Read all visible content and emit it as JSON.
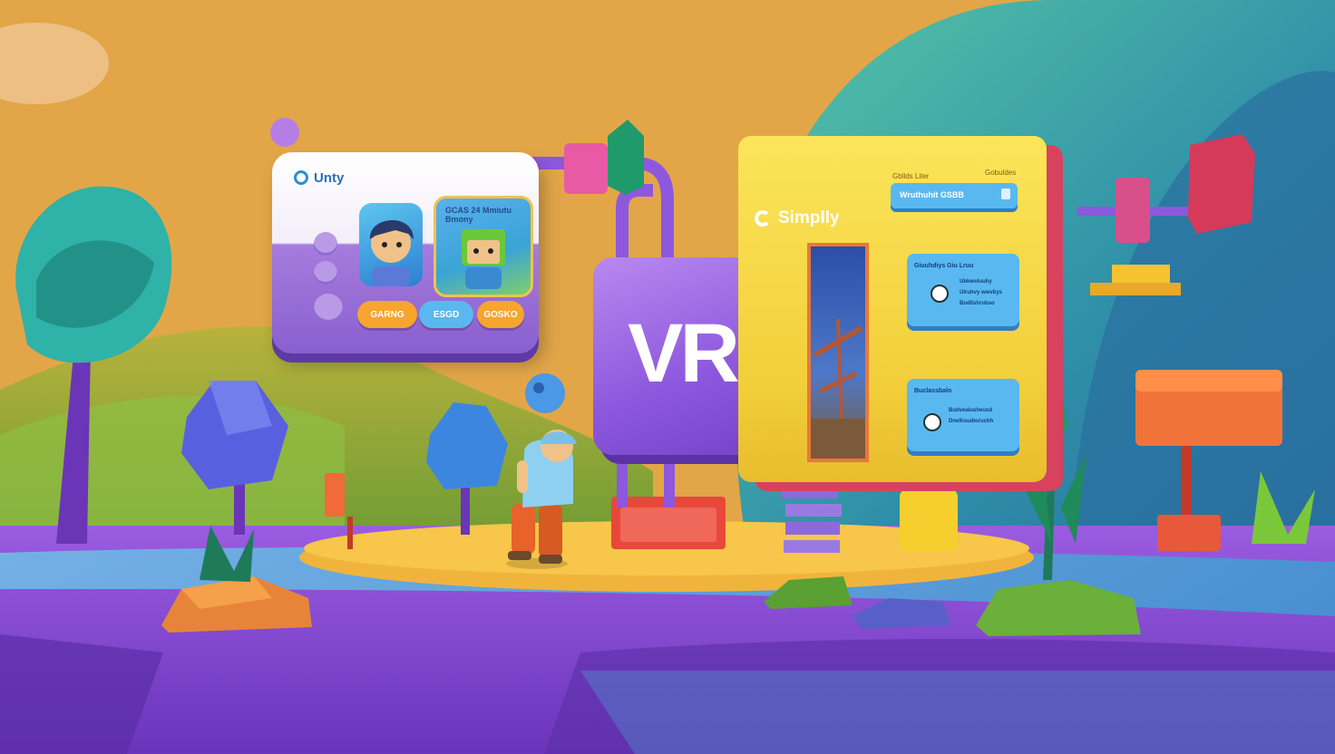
{
  "scene": {
    "colors": {
      "sky": "#e2a648",
      "ground": "#7d43c9",
      "accent_purple": "#8d58dd",
      "board_yellow": "#f2cf3b",
      "panel_blue": "#5ab8f0"
    }
  },
  "unity_panel": {
    "title": "Unty",
    "logo_icon": "unity-logo-icon",
    "card_label": "GCAS 24 Mmiutu  Bmony",
    "buttons": [
      "GARNG",
      "ESGD",
      "GOSKO"
    ]
  },
  "vr_sign": {
    "text": "VR"
  },
  "simply_board": {
    "title": "Simplly",
    "logo_icon": "simply-logo-icon",
    "top_tiny_1": "Gbllds Liter",
    "top_tiny_2": "Gobuldes",
    "search_label": "Wruthuhit GSBB",
    "info_cards": [
      {
        "heading": "Giuuhdiys Giu Lruu",
        "lines": [
          "Ubhwvluuhy",
          "Ulruhvy wwvbys",
          "Bodllshrubso"
        ]
      },
      {
        "heading": "Buclassbalo",
        "lines": [
          "Budvealusheusd",
          "Dnelhsudioruchh"
        ]
      }
    ]
  }
}
